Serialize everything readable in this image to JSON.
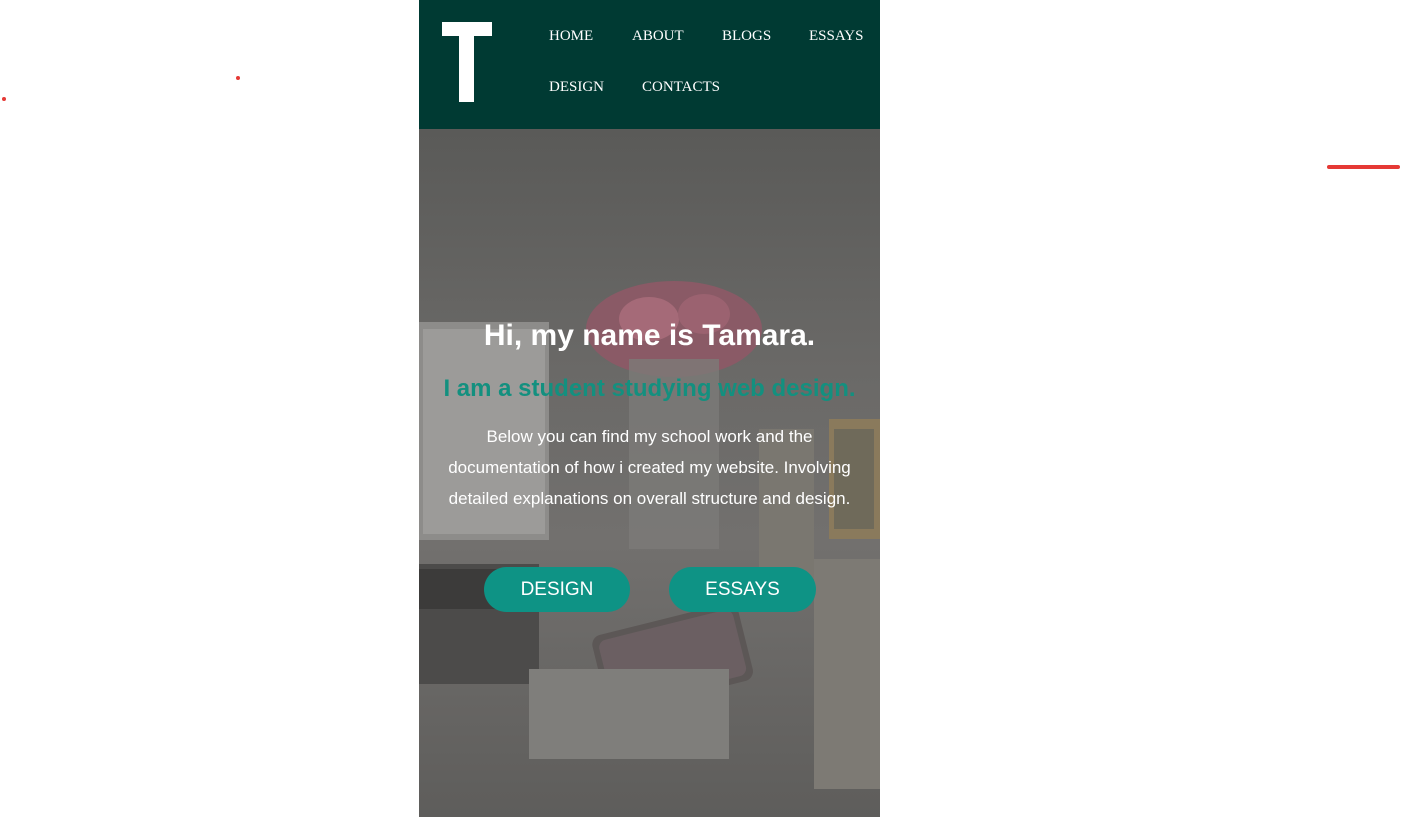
{
  "header": {
    "logo_letter": "T",
    "nav": {
      "home": "HOME",
      "about": "ABOUT",
      "blogs": "BLOGS",
      "essays": "ESSAYS",
      "design": "DESIGN",
      "contacts": "CONTACTS"
    }
  },
  "hero": {
    "heading": "Hi, my name is Tamara.",
    "subheading": "I am a student studying web design.",
    "intro": "Below you can find my school work and the documentation of how i created my website. Involving detailed explanations on overall structure and design.",
    "buttons": {
      "design": "DESIGN",
      "essays": "ESSAYS"
    }
  },
  "colors": {
    "header_bg": "#003a33",
    "accent": "#0e9385",
    "subheading": "#13907f",
    "marks": "#e53935"
  }
}
